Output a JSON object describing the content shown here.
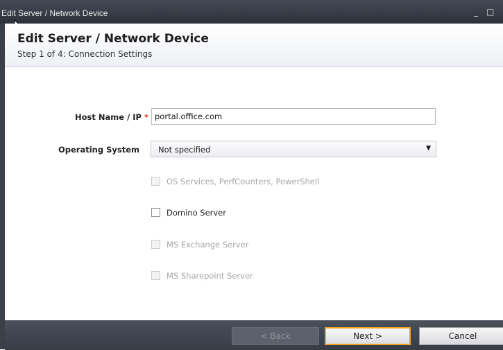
{
  "window": {
    "title": "Edit Server / Network Device",
    "minimize_glyph": "_",
    "maximize_glyph": "□"
  },
  "header": {
    "title": "Edit Server / Network Device",
    "subtitle": "Step 1 of 4: Connection Settings"
  },
  "form": {
    "host_label": "Host Name / IP",
    "required_mark": "*",
    "host_value": "portal.office.com",
    "os_label": "Operating System",
    "os_value": "Not specified",
    "dropdown_glyph": "▼",
    "options": [
      {
        "label": "OS Services, PerfCounters, PowerShell",
        "enabled": false
      },
      {
        "label": "Domino Server",
        "enabled": true
      },
      {
        "label": "MS Exchange Server",
        "enabled": false
      },
      {
        "label": "MS Sharepoint Server",
        "enabled": false
      }
    ]
  },
  "buttons": {
    "back": "< Back",
    "next": "Next >",
    "cancel": "Cancel"
  },
  "colors": {
    "required": "#e03a2e",
    "focus_border": "#f0a020",
    "chrome": "#3a3f48"
  },
  "icons": {
    "cursor": "mouse-pointer-icon"
  }
}
